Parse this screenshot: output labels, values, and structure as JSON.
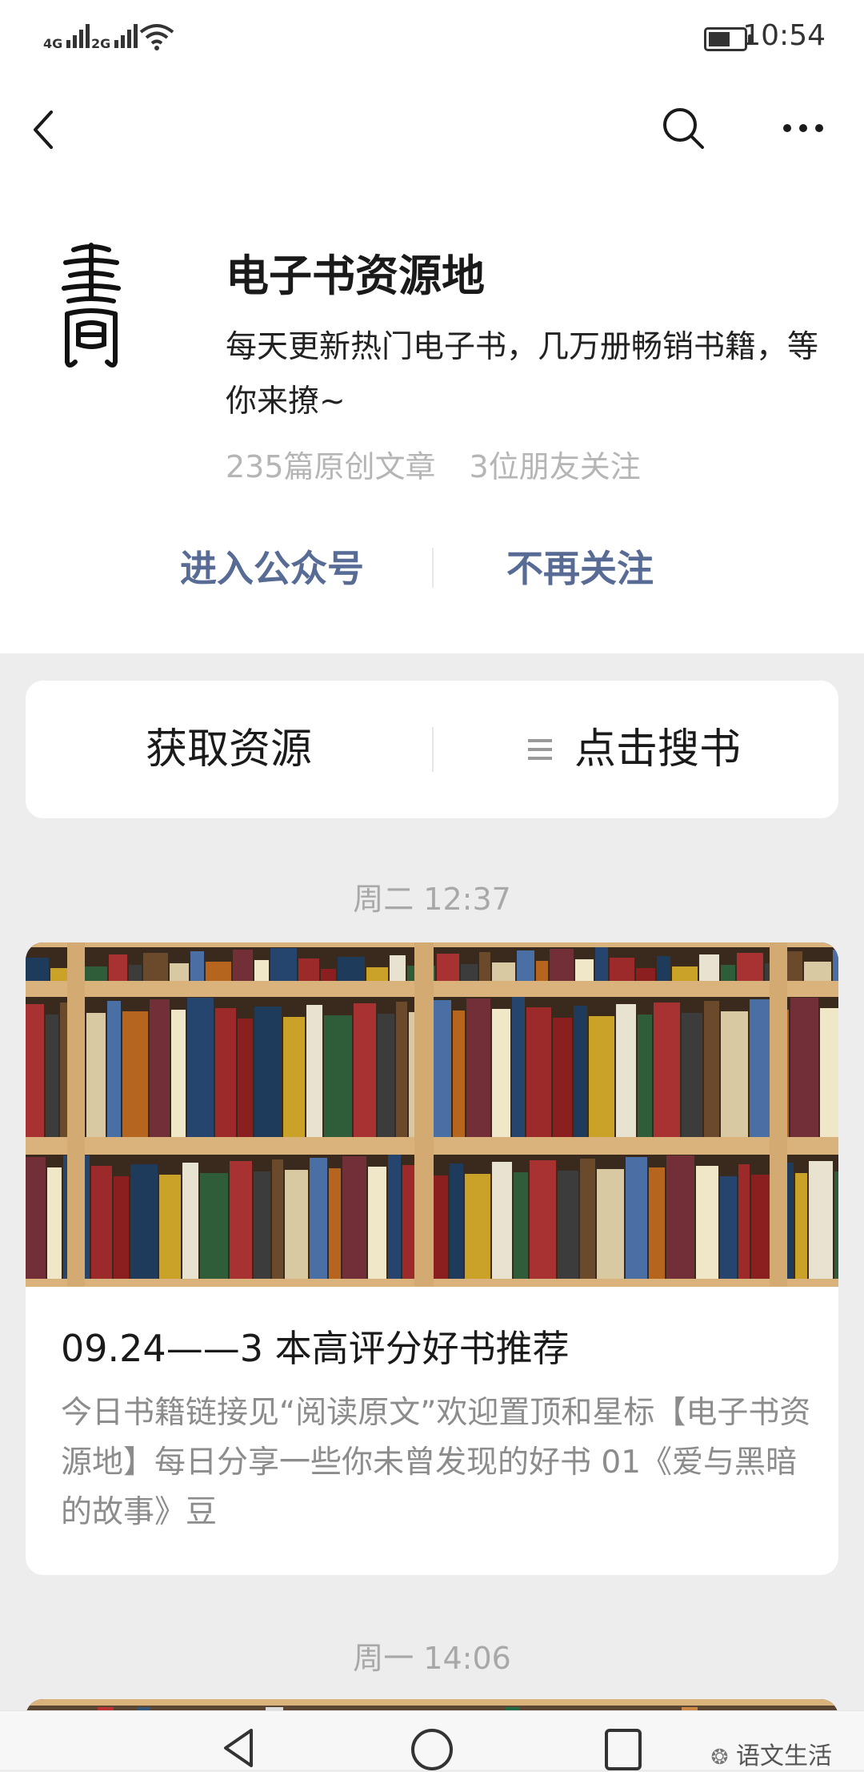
{
  "status_bar": {
    "signal1": "4G",
    "signal2": "2G",
    "time": "10:54"
  },
  "navbar": {
    "icons": [
      "back-arrow-icon",
      "search-icon",
      "more-icon"
    ]
  },
  "profile": {
    "name": "电子书资源地",
    "description": "每天更新热门电子书，几万册畅销书籍，等你来撩~",
    "stats": {
      "articles": "235篇原创文章",
      "friends": "3位朋友关注"
    },
    "actions": {
      "enter": "进入公众号",
      "unfollow": "不再关注"
    }
  },
  "menu": {
    "left": "获取资源",
    "right": "点击搜书",
    "right_icon": "menu-lines-icon"
  },
  "feed": {
    "timestamp1": "周二 12:37",
    "article": {
      "title": "09.24——3 本高评分好书推荐",
      "summary": "今日书籍链接见“阅读原文”欢迎置顶和星标【电子书资源地】每日分享一些你未曾发现的好书 01《爱与黑暗的故事》豆"
    },
    "timestamp2": "周一 14:06"
  },
  "watermark": "语文生活",
  "colors": {
    "link": "#576b95",
    "background": "#ededed",
    "shelf_wood": "#d9b27c"
  }
}
